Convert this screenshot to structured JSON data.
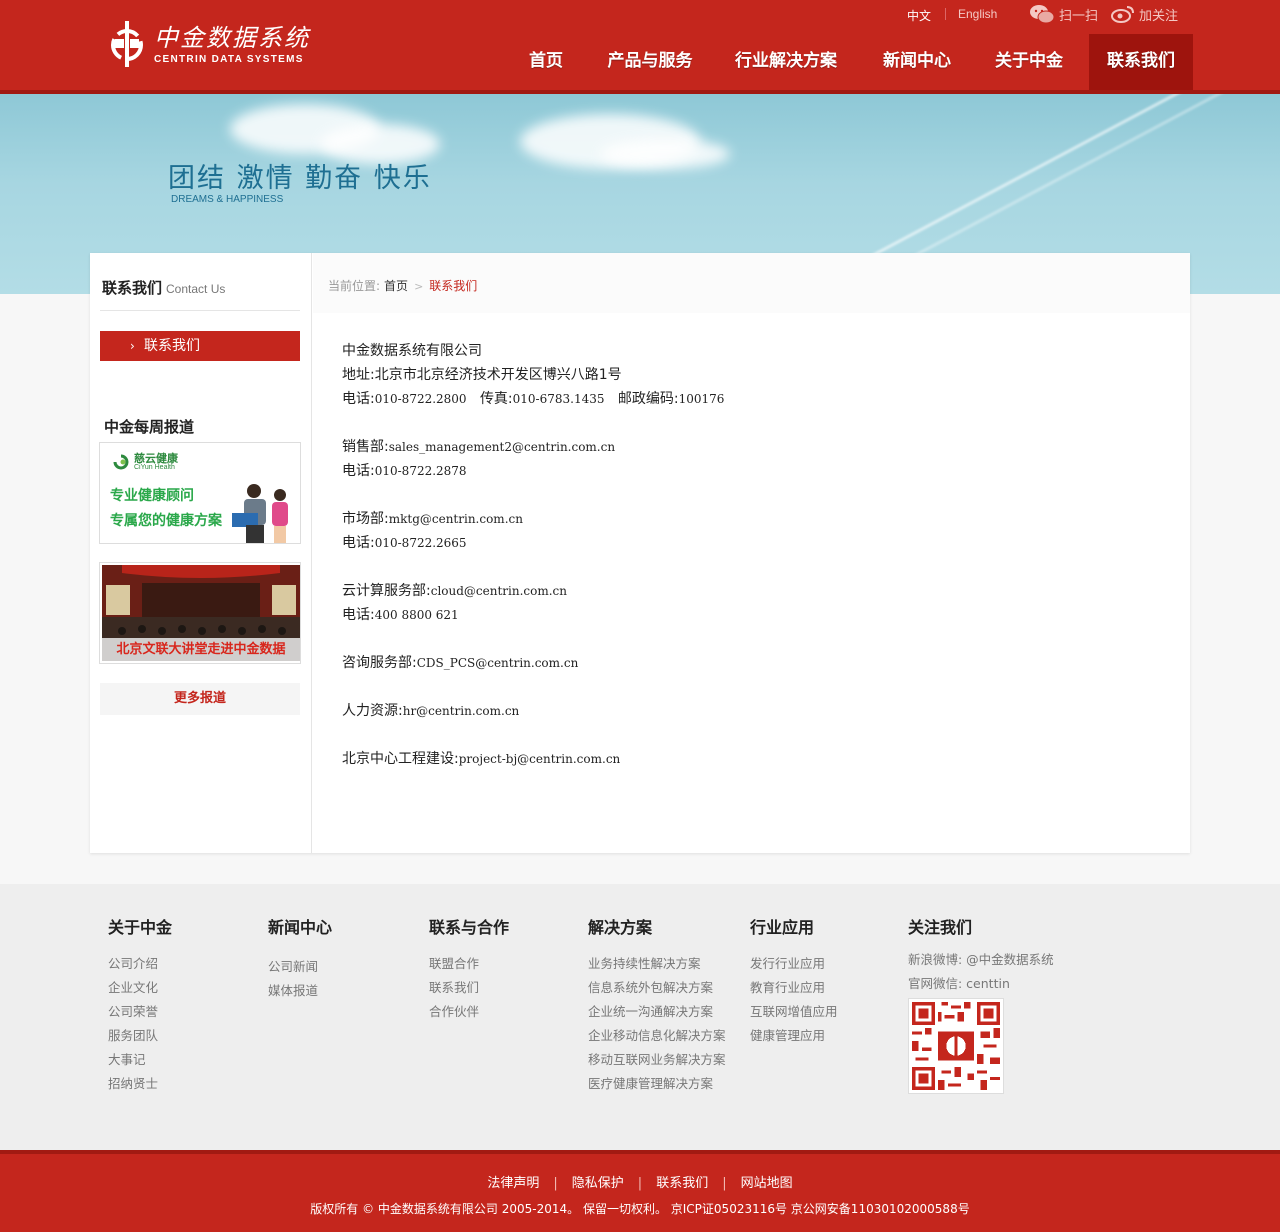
{
  "header": {
    "logo_cn": "中金数据系统",
    "logo_en": "CENTRIN DATA SYSTEMS",
    "lang_cn": "中文",
    "lang_en": "English",
    "scan_label": "扫一扫",
    "follow_label": "加关注",
    "nav": [
      "首页",
      "产品与服务",
      "行业解决方案",
      "新闻中心",
      "关于中金",
      "联系我们"
    ],
    "active_nav": "联系我们"
  },
  "banner": {
    "slogan": "团结 激情 勤奋 快乐",
    "slogan_en": "DREAMS & HAPPINESS"
  },
  "sidebar": {
    "title": "联系我们",
    "title_en": "Contact Us",
    "menu_item": "联系我们",
    "weekly_title": "中金每周报道",
    "ad1_brand_cn": "慈云健康",
    "ad1_brand_en": "CiYun Health",
    "ad1_line1": "专业健康顾问",
    "ad1_line2": "专属您的健康方案",
    "ad2_caption": "北京文联大讲堂走进中金数据",
    "more_news": "更多报道"
  },
  "breadcrumb": {
    "prefix": "当前位置:",
    "home": "首页",
    "current": "联系我们"
  },
  "contact": {
    "company": "中金数据系统有限公司",
    "address_label": "地址:",
    "address": "北京市北京经济技术开发区博兴八路1号",
    "phone_label": "电话:",
    "phone": "010-8722.2800",
    "fax_label": "传真:",
    "fax": "010-6783.1435",
    "zip_label": "邮政编码:",
    "zip": "100176",
    "sales_label": "销售部:",
    "sales_email": "sales_management2@centrin.com.cn",
    "sales_phone": "010-8722.2878",
    "market_label": "市场部:",
    "market_email": "mktg@centrin.com.cn",
    "market_phone": "010-8722.2665",
    "cloud_label": "云计算服务部:",
    "cloud_email": "cloud@centrin.com.cn",
    "cloud_phone": "400 8800 621",
    "consult_label": "咨询服务部:",
    "consult_email": "CDS_PCS@centrin.com.cn",
    "hr_label": "人力资源:",
    "hr_email": "hr@centrin.com.cn",
    "project_label": "北京中心工程建设:",
    "project_email": "project-bj@centrin.com.cn"
  },
  "footer": {
    "columns": [
      {
        "title": "关于中金",
        "items": [
          "公司介绍",
          "企业文化",
          "公司荣誉",
          "服务团队",
          "大事记",
          "招纳贤士"
        ]
      },
      {
        "title": "新闻中心",
        "items": [
          "公司新闻",
          "媒体报道"
        ]
      },
      {
        "title": "联系与合作",
        "items": [
          "联盟合作",
          "联系我们",
          "合作伙伴"
        ]
      },
      {
        "title": "解决方案",
        "items": [
          "业务持续性解决方案",
          "信息系统外包解决方案",
          "企业统一沟通解决方案",
          "企业移动信息化解决方案",
          "移动互联网业务解决方案",
          "医疗健康管理解决方案"
        ]
      },
      {
        "title": "行业应用",
        "items": [
          "发行行业应用",
          "教育行业应用",
          "互联网增值应用",
          "健康管理应用"
        ]
      },
      {
        "title": "关注我们",
        "items": [
          "新浪微博: @中金数据系统",
          "官网微信: centtin"
        ]
      }
    ],
    "links": [
      "法律声明",
      "隐私保护",
      "联系我们",
      "网站地图"
    ],
    "copyright": "版权所有 © 中金数据系统有限公司 2005-2014。 保留一切权利。 京ICP证05023116号 京公网安备11030102000588号"
  },
  "colors": {
    "brand_red": "#c4261d",
    "dark_red": "#9e140d",
    "banner_blue": "#a7d6e1",
    "slogan_blue": "#1e6f92"
  }
}
